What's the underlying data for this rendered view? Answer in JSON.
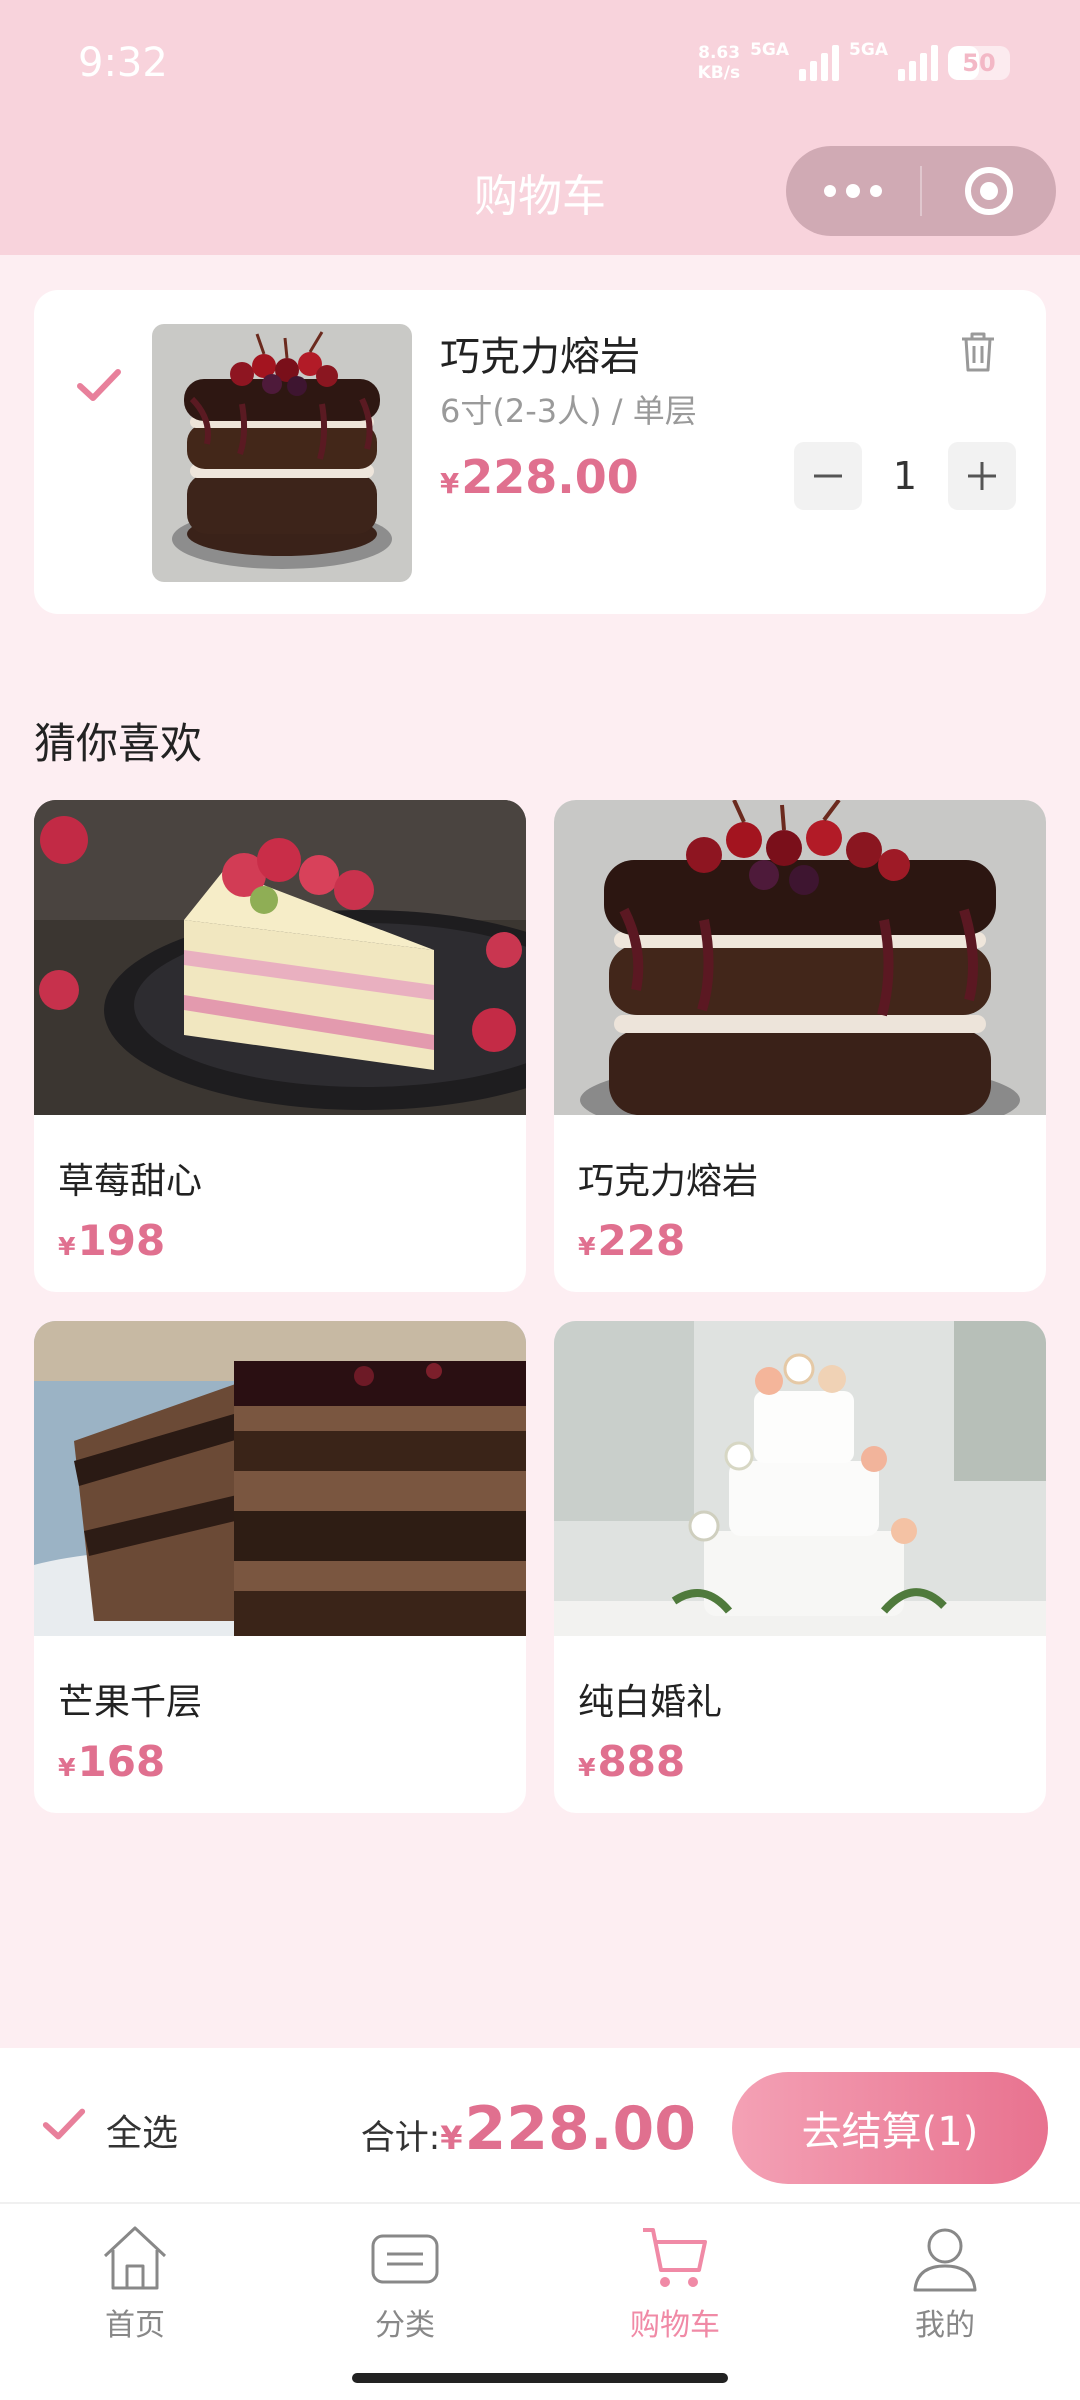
{
  "status_bar": {
    "time": "9:32",
    "net_speed_value": "8.63",
    "net_speed_unit": "KB/s",
    "signal1_label": "5GA",
    "signal2_label": "5GA",
    "battery": "50"
  },
  "header": {
    "title": "购物车",
    "capsule_more_icon": "more-dots-icon",
    "capsule_close_icon": "target-icon"
  },
  "cart": {
    "items": [
      {
        "name": "巧克力熔岩",
        "spec": "6寸(2-3人) / 单层",
        "currency": "¥",
        "price": "228.00",
        "quantity": "1",
        "checked": true,
        "image_icon": "chocolate-layer-cake"
      }
    ]
  },
  "recommend": {
    "title": "猜你喜欢",
    "products": [
      {
        "name": "草莓甜心",
        "currency": "¥",
        "price": "198",
        "image_icon": "strawberry-cake-slice"
      },
      {
        "name": "巧克力熔岩",
        "currency": "¥",
        "price": "228",
        "image_icon": "chocolate-layer-cake"
      },
      {
        "name": "芒果千层",
        "currency": "¥",
        "price": "168",
        "image_icon": "chocolate-mousse-slice"
      },
      {
        "name": "纯白婚礼",
        "currency": "¥",
        "price": "888",
        "image_icon": "white-wedding-cake"
      }
    ]
  },
  "checkout": {
    "select_all_label": "全选",
    "total_label": "合计:",
    "currency": "¥",
    "total_amount": "228.00",
    "pay_button": "去结算(1)"
  },
  "tabbar": {
    "tabs": [
      {
        "label": "首页",
        "icon": "home-icon",
        "active": false
      },
      {
        "label": "分类",
        "icon": "category-icon",
        "active": false
      },
      {
        "label": "购物车",
        "icon": "cart-icon",
        "active": true
      },
      {
        "label": "我的",
        "icon": "user-icon",
        "active": false
      }
    ]
  },
  "colors": {
    "header_bg": "#f8d3dc",
    "page_bg": "#fdeef2",
    "accent": "#e0708f",
    "tab_active": "#f08aa6"
  }
}
